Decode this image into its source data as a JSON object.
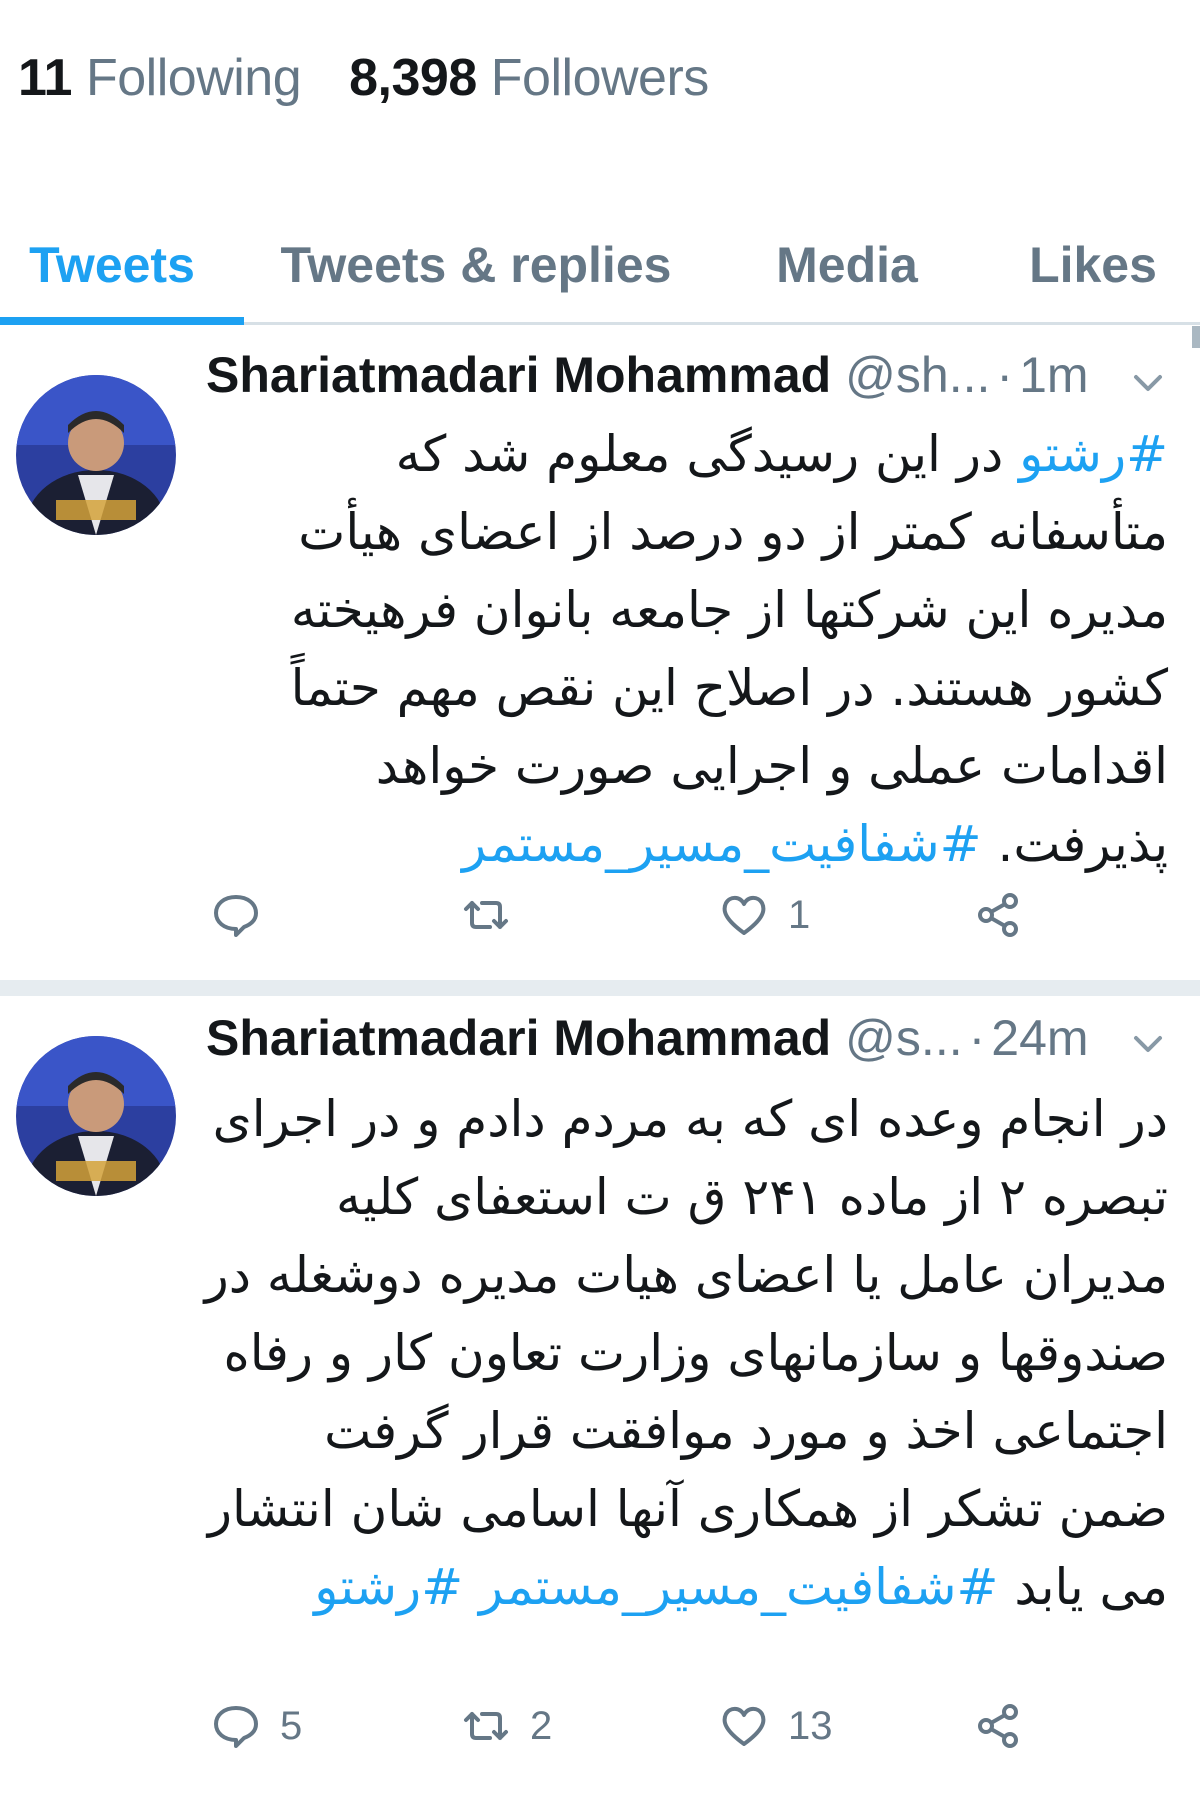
{
  "profile_stats": {
    "following_count": "11",
    "following_label": "Following",
    "followers_count": "8,398",
    "followers_label": "Followers"
  },
  "tabs": [
    {
      "label": "Tweets",
      "active": true
    },
    {
      "label": "Tweets & replies",
      "active": false
    },
    {
      "label": "Media",
      "active": false
    },
    {
      "label": "Likes",
      "active": false
    }
  ],
  "colors": {
    "accent": "#1da1f2",
    "muted_text": "#657786",
    "primary_text": "#14171a",
    "separator": "#e6ecf0"
  },
  "tweets": [
    {
      "author_name": "Shariatmadari Mohammad",
      "handle": "@sh...",
      "time": "1m",
      "text_parts": {
        "hashtag_start": "#رشتو",
        "body": " در این رسیدگی معلوم شد که متأسفانه کمتر از دو درصد از اعضای هیأت مدیره این شرکتها از جامعه بانوان فرهیخته کشور هستند. در اصلاح این نقص مهم حتماً اقدامات عملی و اجرایی صورت خواهد پذیرفت. ",
        "hashtag_end": "#شفافیت_مسیر_مستمر"
      },
      "actions": {
        "reply_icon": "reply-icon",
        "reply_count": "",
        "retweet_icon": "retweet-icon",
        "retweet_count": "",
        "like_icon": "heart-icon",
        "like_count": "1",
        "share_icon": "share-icon"
      }
    },
    {
      "author_name": "Shariatmadari Mohammad",
      "handle": "@s...",
      "time": "24m",
      "text_parts": {
        "body": "در انجام وعده ای که به مردم دادم و در اجرای تبصره ۲ از ماده ۲۴۱ ق ت استعفای کلیه مدیران عامل یا اعضای هیات مدیره دوشغله در صندوقها و سازمانهای وزارت تعاون کار و رفاه اجتماعی اخذ و مورد موافقت قرار گرفت ضمن تشکر از همکاری آنها اسامی شان انتشار می یابد ",
        "hashtag_mid": "#شفافیت_مسیر_مستمر",
        "hashtag_end": "#رشتو"
      },
      "actions": {
        "reply_icon": "reply-icon",
        "reply_count": "5",
        "retweet_icon": "retweet-icon",
        "retweet_count": "2",
        "like_icon": "heart-icon",
        "like_count": "13",
        "share_icon": "share-icon"
      }
    }
  ]
}
